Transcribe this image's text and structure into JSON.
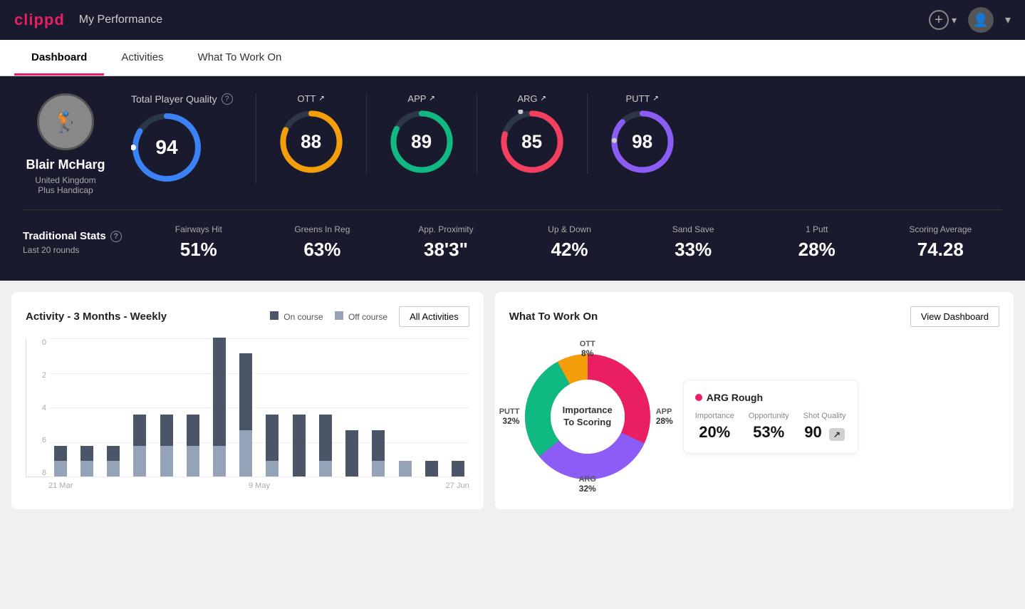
{
  "app": {
    "logo": "clippd",
    "nav_title": "My Performance",
    "add_btn_label": "+",
    "user_dropdown": "▾"
  },
  "tabs": [
    {
      "id": "dashboard",
      "label": "Dashboard",
      "active": true
    },
    {
      "id": "activities",
      "label": "Activities",
      "active": false
    },
    {
      "id": "what_to_work_on",
      "label": "What To Work On",
      "active": false
    }
  ],
  "player": {
    "name": "Blair McHarg",
    "location": "United Kingdom",
    "handicap": "Plus Handicap",
    "avatar_emoji": "🏌️"
  },
  "quality": {
    "title": "Total Player Quality",
    "main_score": 94,
    "main_color": "#3b82f6",
    "categories": [
      {
        "id": "ott",
        "label": "OTT",
        "score": 88,
        "color": "#f59e0b"
      },
      {
        "id": "app",
        "label": "APP",
        "score": 89,
        "color": "#10b981"
      },
      {
        "id": "arg",
        "label": "ARG",
        "score": 85,
        "color": "#f43f5e"
      },
      {
        "id": "putt",
        "label": "PUTT",
        "score": 98,
        "color": "#8b5cf6"
      }
    ]
  },
  "traditional_stats": {
    "title": "Traditional Stats",
    "subtitle": "Last 20 rounds",
    "stats": [
      {
        "label": "Fairways Hit",
        "value": "51%"
      },
      {
        "label": "Greens In Reg",
        "value": "63%"
      },
      {
        "label": "App. Proximity",
        "value": "38'3\""
      },
      {
        "label": "Up & Down",
        "value": "42%"
      },
      {
        "label": "Sand Save",
        "value": "33%"
      },
      {
        "label": "1 Putt",
        "value": "28%"
      },
      {
        "label": "Scoring Average",
        "value": "74.28"
      }
    ]
  },
  "activity_chart": {
    "title": "Activity - 3 Months - Weekly",
    "legend": {
      "on_course": "On course",
      "off_course": "Off course"
    },
    "all_activities_btn": "All Activities",
    "y_labels": [
      "0",
      "2",
      "4",
      "6",
      "8"
    ],
    "x_labels": [
      "21 Mar",
      "9 May",
      "27 Jun"
    ],
    "bars": [
      {
        "on": 1,
        "off": 1
      },
      {
        "on": 1,
        "off": 1
      },
      {
        "on": 1,
        "off": 1
      },
      {
        "on": 2,
        "off": 2
      },
      {
        "on": 2,
        "off": 2
      },
      {
        "on": 2,
        "off": 2
      },
      {
        "on": 7,
        "off": 2
      },
      {
        "on": 5,
        "off": 3
      },
      {
        "on": 3,
        "off": 1
      },
      {
        "on": 4,
        "off": 0
      },
      {
        "on": 3,
        "off": 1
      },
      {
        "on": 3,
        "off": 0
      },
      {
        "on": 2,
        "off": 1
      },
      {
        "on": 0,
        "off": 1
      },
      {
        "on": 1,
        "off": 0
      },
      {
        "on": 1,
        "off": 0
      }
    ]
  },
  "what_to_work_on": {
    "title": "What To Work On",
    "view_dashboard_btn": "View Dashboard",
    "donut_center": "Importance\nTo Scoring",
    "segments": [
      {
        "label": "OTT",
        "value": "8%",
        "color": "#f59e0b"
      },
      {
        "label": "APP",
        "value": "28%",
        "color": "#10b981"
      },
      {
        "label": "ARG",
        "value": "32%",
        "color": "#e91e63"
      },
      {
        "label": "PUTT",
        "value": "32%",
        "color": "#8b5cf6"
      }
    ],
    "highlighted_item": {
      "title": "ARG Rough",
      "dot_color": "#e91e63",
      "metrics": [
        {
          "label": "Importance",
          "value": "20%"
        },
        {
          "label": "Opportunity",
          "value": "53%"
        },
        {
          "label": "Shot Quality",
          "value": "90",
          "badge": "↗"
        }
      ]
    }
  }
}
